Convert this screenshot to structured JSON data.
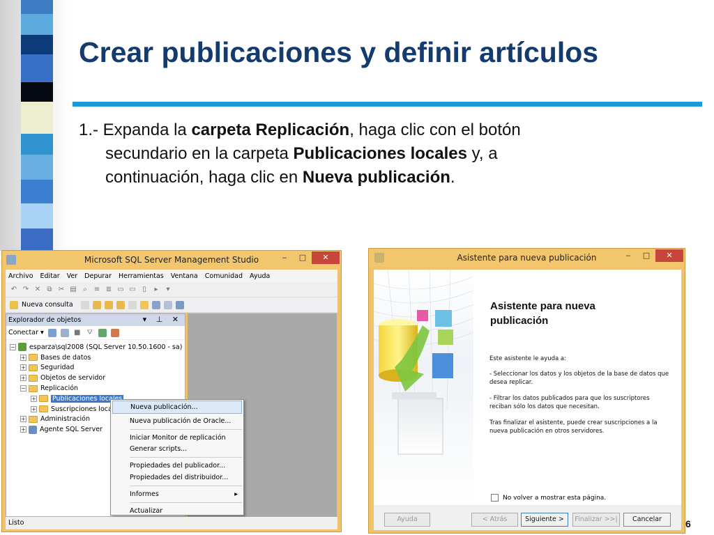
{
  "slide": {
    "title": "Crear publicaciones y definir artículos",
    "page_number": "6",
    "step_prefix": "1.- Expanda la ",
    "step_b1": "carpeta Replicación",
    "step_t2": ", haga clic con el botón",
    "step_t3": "secundario en la carpeta ",
    "step_b2": "Publicaciones locales",
    "step_t4": " y, a",
    "step_t5": "continuación, haga clic en ",
    "step_b3": "Nueva publicación",
    "step_t6": "."
  },
  "ssms": {
    "title": "Microsoft SQL Server Management Studio",
    "menu": [
      "Archivo",
      "Editar",
      "Ver",
      "Depurar",
      "Herramientas",
      "Ventana",
      "Comunidad",
      "Ayuda"
    ],
    "new_query": "Nueva consulta",
    "explorer_title": "Explorador de objetos",
    "connect": "Conectar ▾",
    "tree": {
      "server": "esparza\\sql2008 (SQL Server 10.50.1600 - sa)",
      "databases": "Bases de datos",
      "security": "Seguridad",
      "server_objects": "Objetos de servidor",
      "replication": "Replicación",
      "local_publications": "Publicaciones locales",
      "local_subscriptions": "Suscripciones locales",
      "management": "Administración",
      "agent": "Agente SQL Server"
    },
    "status": "Listo",
    "context_menu": {
      "new_publication": "Nueva publicación...",
      "new_oracle_publication": "Nueva publicación de Oracle...",
      "launch_monitor": "Iniciar Monitor de replicación",
      "generate_scripts": "Generar scripts...",
      "publisher_props": "Propiedades del publicador...",
      "distributor_props": "Propiedades del distribuidor...",
      "reports": "Informes",
      "refresh": "Actualizar"
    }
  },
  "wizard": {
    "title": "Asistente para nueva publicación",
    "heading_line1": "Asistente para nueva",
    "heading_line2": "publicación",
    "intro": "Este asistente le ayuda a:",
    "bullet1": "- Seleccionar los datos y los objetos de la base de datos que desea replicar.",
    "bullet2": "- Filtrar los datos publicados para que los suscriptores reciban sólo los datos que necesitan.",
    "after": "Tras finalizar el asistente, puede crear suscripciones a la nueva publicación en otros servidores.",
    "checkbox": "No volver a mostrar esta página.",
    "buttons": {
      "help": "Ayuda",
      "back": "< Atrás",
      "next": "Siguiente >",
      "finish": "Finalizar >>|",
      "cancel": "Cancelar"
    }
  },
  "colors": {
    "title": "#143b6e",
    "rule": "#1b9bd6",
    "window_frame": "#f2c66c",
    "close_button": "#c7453a",
    "selection": "#3b78c8"
  }
}
